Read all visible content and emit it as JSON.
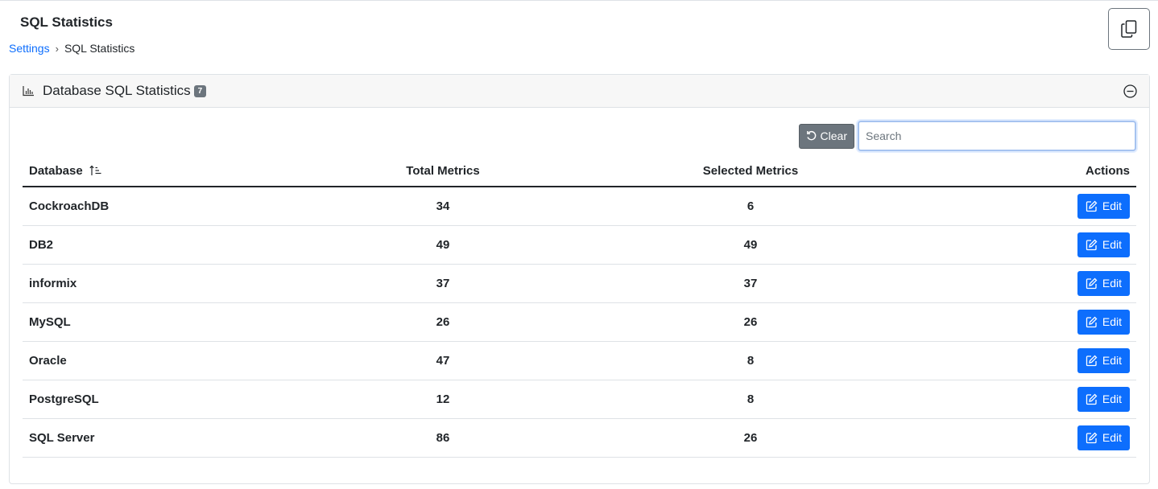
{
  "header": {
    "title": "SQL Statistics",
    "breadcrumb": {
      "parent": "Settings",
      "current": "SQL Statistics"
    }
  },
  "card": {
    "title": "Database SQL Statistics",
    "count": "7",
    "icon": "bar-chart-icon"
  },
  "toolbar": {
    "clear_label": "Clear",
    "search_placeholder": "Search",
    "search_value": ""
  },
  "table": {
    "columns": [
      "Database",
      "Total Metrics",
      "Selected Metrics",
      "Actions"
    ],
    "rows": [
      {
        "database": "CockroachDB",
        "total": "34",
        "selected": "6",
        "action": "Edit"
      },
      {
        "database": "DB2",
        "total": "49",
        "selected": "49",
        "action": "Edit"
      },
      {
        "database": "informix",
        "total": "37",
        "selected": "37",
        "action": "Edit"
      },
      {
        "database": "MySQL",
        "total": "26",
        "selected": "26",
        "action": "Edit"
      },
      {
        "database": "Oracle",
        "total": "47",
        "selected": "8",
        "action": "Edit"
      },
      {
        "database": "PostgreSQL",
        "total": "12",
        "selected": "8",
        "action": "Edit"
      },
      {
        "database": "SQL Server",
        "total": "86",
        "selected": "26",
        "action": "Edit"
      }
    ]
  },
  "colors": {
    "primary": "#0d6efd",
    "secondary": "#6c757d",
    "border": "#dee2e6"
  }
}
